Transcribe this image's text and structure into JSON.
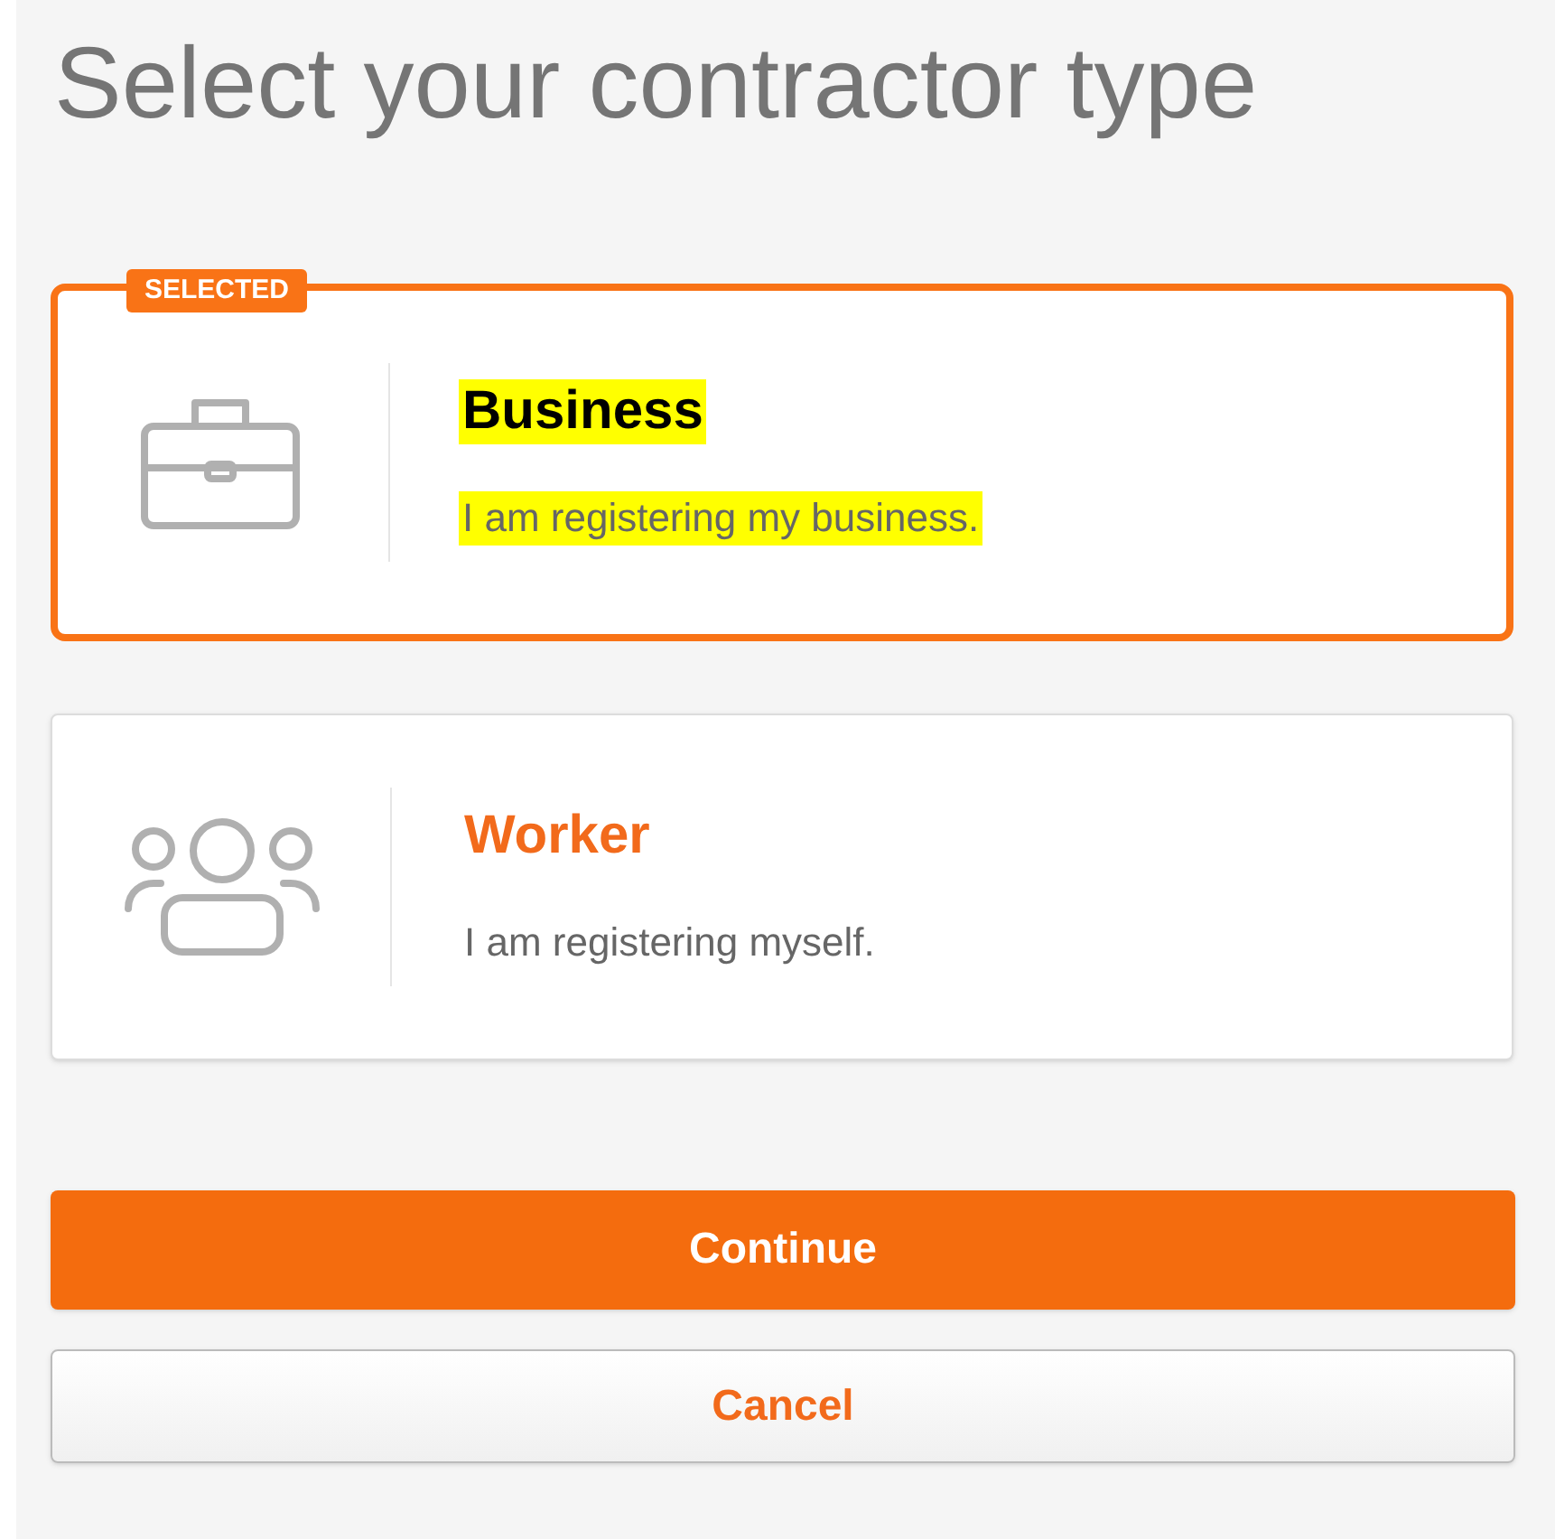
{
  "heading": "Select your contractor type",
  "options": [
    {
      "kind": "briefcase",
      "title": "Business",
      "description": "I am registering my business.",
      "selected": true,
      "badge": "SELECTED",
      "highlighted": true
    },
    {
      "kind": "people",
      "title": "Worker",
      "description": "I am registering myself.",
      "selected": false,
      "highlighted": false
    }
  ],
  "buttons": [
    {
      "kind": "primary",
      "label": "Continue"
    },
    {
      "kind": "secondary",
      "label": "Cancel"
    }
  ]
}
